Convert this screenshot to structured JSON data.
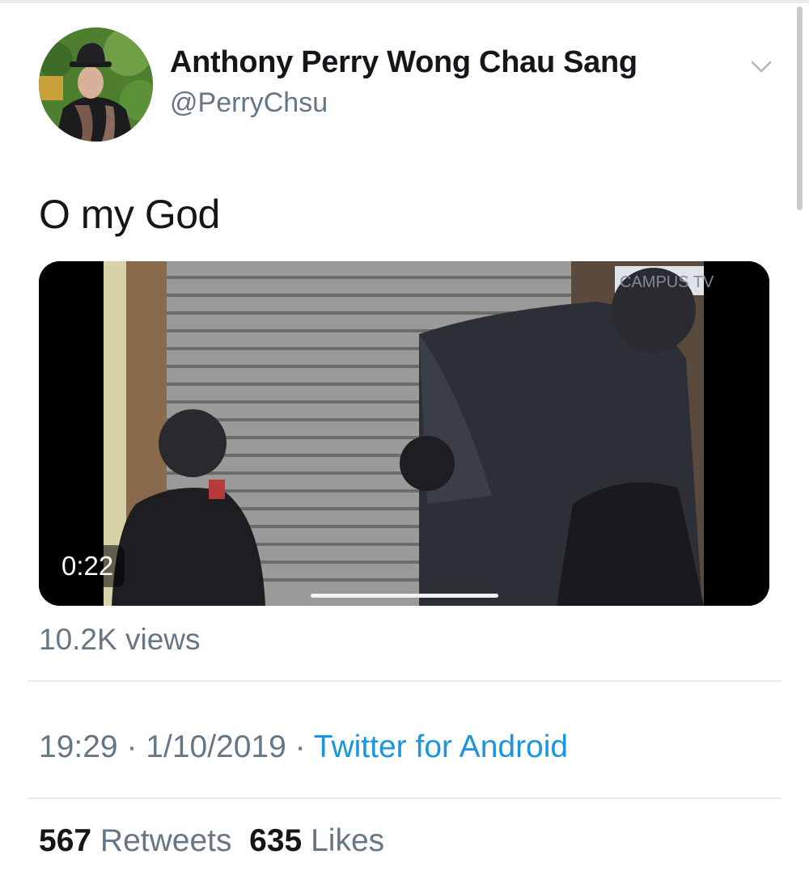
{
  "user": {
    "name": "Anthony Perry Wong Chau Sang",
    "handle": "@PerryChsu"
  },
  "tweet": {
    "text": "O my God"
  },
  "video": {
    "duration": "0:22",
    "watermark": "CAMPUS TV",
    "progress": 0.5
  },
  "views": "10.2K views",
  "meta": {
    "time": "19:29",
    "separator": "·",
    "date": "1/10/2019",
    "source": "Twitter for Android"
  },
  "stats": {
    "retweets_count": "567",
    "retweets_label": "Retweets",
    "likes_count": "635",
    "likes_label": "Likes"
  },
  "colors": {
    "link": "#1b95e0",
    "secondary_text": "#657786",
    "primary_text": "#14171a"
  }
}
